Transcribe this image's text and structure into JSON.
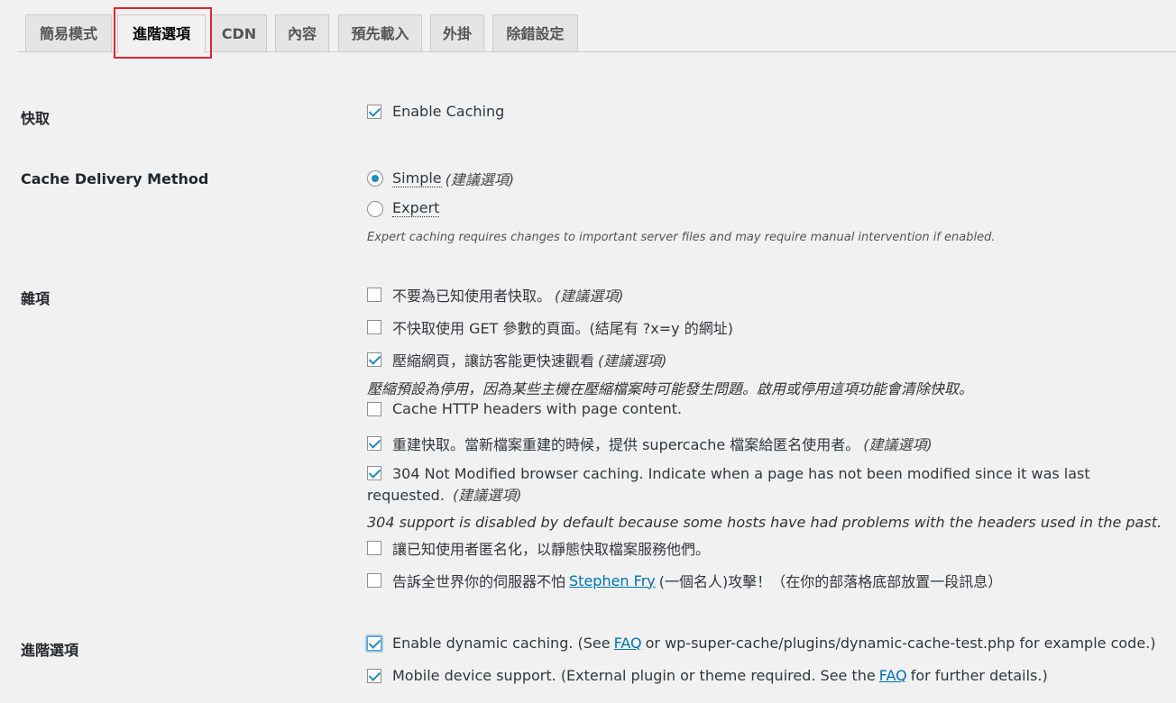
{
  "tabs": [
    {
      "label": "簡易模式",
      "active": false
    },
    {
      "label": "進階選項",
      "active": true
    },
    {
      "label": "CDN",
      "active": false
    },
    {
      "label": "內容",
      "active": false
    },
    {
      "label": "預先載入",
      "active": false
    },
    {
      "label": "外掛",
      "active": false
    },
    {
      "label": "除錯設定",
      "active": false
    }
  ],
  "colors": {
    "accent": "#1e8cbe",
    "link": "#0073aa",
    "highlight_box": "#e0252c"
  },
  "recommended": "(建議選項)",
  "caching": {
    "label": "快取",
    "enable_caching": {
      "label": "Enable Caching",
      "checked": true
    }
  },
  "delivery": {
    "label": "Cache Delivery Method",
    "simple": {
      "label": "Simple",
      "checked": true
    },
    "expert": {
      "label": "Expert",
      "checked": false
    },
    "note": "Expert caching requires changes to important server files and may require manual intervention if enabled."
  },
  "misc": {
    "label": "雜項",
    "no_cache_known_users": {
      "label": "不要為已知使用者快取。",
      "checked": false
    },
    "no_cache_get": {
      "label": "不快取使用 GET 參數的頁面。(結尾有 ?x=y 的網址)",
      "checked": false
    },
    "compress": {
      "label": "壓縮網頁，讓訪客能更快速觀看",
      "checked": true
    },
    "compress_note": "壓縮預設為停用，因為某些主機在壓縮檔案時可能發生問題。啟用或停用這項功能會清除快取。",
    "cache_http_headers": {
      "label": "Cache HTTP headers with page content.",
      "checked": false
    },
    "rebuild": {
      "label": "重建快取。當新檔案重建的時候，提供 supercache 檔案給匿名使用者。",
      "checked": true
    },
    "not_modified": {
      "label": "304 Not Modified browser caching. Indicate when a page has not been modified since it was last requested.",
      "checked": true
    },
    "not_modified_rec": "(建議選項)",
    "not_modified_note": "304 support is disabled by default because some hosts have had problems with the headers used in the past.",
    "anonymize": {
      "label": "讓已知使用者匿名化，以靜態快取檔案服務他們。",
      "checked": false
    },
    "tell_world": {
      "before": "告訴全世界你的伺服器不怕",
      "link": "Stephen Fry",
      "after": "(一個名人)攻擊！（在你的部落格底部放置一段訊息）",
      "checked": false
    }
  },
  "advanced": {
    "label": "進階選項",
    "dynamic": {
      "before": "Enable dynamic caching. (See",
      "link": "FAQ",
      "after": "or wp-super-cache/plugins/dynamic-cache-test.php for example code.)",
      "checked": true
    },
    "mobile": {
      "before": "Mobile device support. (External plugin or theme required. See the",
      "link": "FAQ",
      "after": "for further details.)",
      "checked": true
    }
  }
}
